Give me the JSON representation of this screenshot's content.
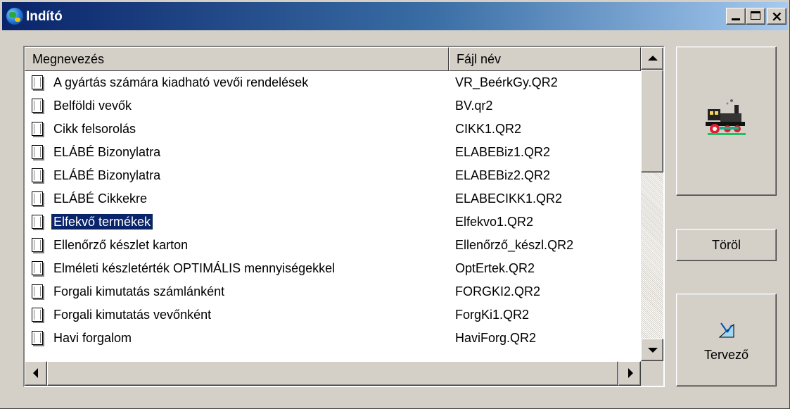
{
  "window": {
    "title": "Indító",
    "controls": {
      "minimize_icon": "minimize-icon",
      "maximize_icon": "maximize-icon",
      "close_glyph": "×"
    }
  },
  "list": {
    "columns": [
      "Megnevezés",
      "Fájl név"
    ],
    "selected_index": 6,
    "rows": [
      {
        "name": "A gyártás számára kiadható vevői rendelések",
        "file": "VR_BeérkGy.QR2"
      },
      {
        "name": "Belföldi vevők",
        "file": "BV.qr2"
      },
      {
        "name": "Cikk felsorolás",
        "file": "CIKK1.QR2"
      },
      {
        "name": "ELÁBÉ Bizonylatra",
        "file": "ELABEBiz1.QR2"
      },
      {
        "name": "ELÁBÉ Bizonylatra",
        "file": "ELABEBiz2.QR2"
      },
      {
        "name": "ELÁBÉ Cikkekre",
        "file": "ELABECIKK1.QR2"
      },
      {
        "name": "Elfekvő termékek",
        "file": "Elfekvo1.QR2"
      },
      {
        "name": "Ellenőrző készlet karton",
        "file": "Ellenőrző_készl.QR2"
      },
      {
        "name": "Elméleti készletérték OPTIMÁLIS mennyiségekkel",
        "file": "OptErtek.QR2"
      },
      {
        "name": "Forgali kimutatás számlánként",
        "file": "FORGKI2.QR2"
      },
      {
        "name": "Forgali kimutatás vevőnként",
        "file": "ForgKi1.QR2"
      },
      {
        "name": "Havi forgalom",
        "file": "HaviForg.QR2"
      }
    ]
  },
  "buttons": {
    "run_icon": "locomotive-icon",
    "delete_label": "Töröl",
    "design_label": "Tervező",
    "design_icon": "design-triangle-icon"
  },
  "colors": {
    "titlebar_start": "#0a246a",
    "titlebar_end": "#a6caf0",
    "selection": "#0a246a",
    "face": "#d4d0c8"
  }
}
